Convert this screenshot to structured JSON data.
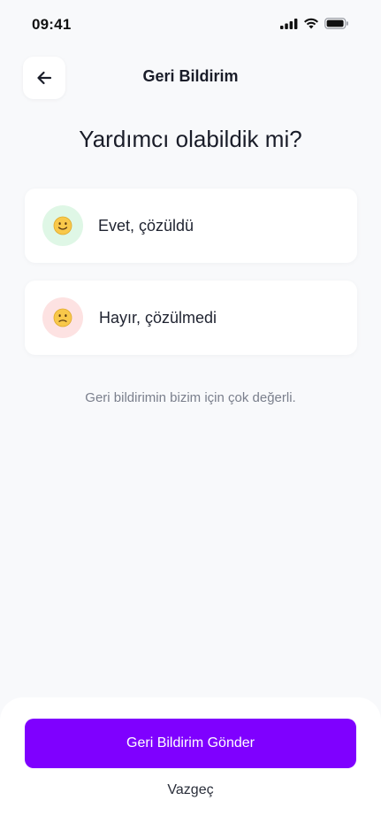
{
  "status_bar": {
    "time": "09:41"
  },
  "header": {
    "title": "Geri Bildirim",
    "back_icon": "arrow-left-icon"
  },
  "question": "Yardımcı olabildik mi?",
  "options": [
    {
      "label": "Evet, çözüldü",
      "icon": "slightly-smiling-face-icon",
      "accent": "#dff7e6"
    },
    {
      "label": "Hayır, çözülmedi",
      "icon": "confused-face-icon",
      "accent": "#fde2e2"
    }
  ],
  "hint": "Geri bildirimin bizim için çok değerli.",
  "footer": {
    "submit_label": "Geri Bildirim Gönder",
    "cancel_label": "Vazgeç"
  },
  "colors": {
    "primary": "#7f00ff",
    "background": "#f8f9fb"
  }
}
